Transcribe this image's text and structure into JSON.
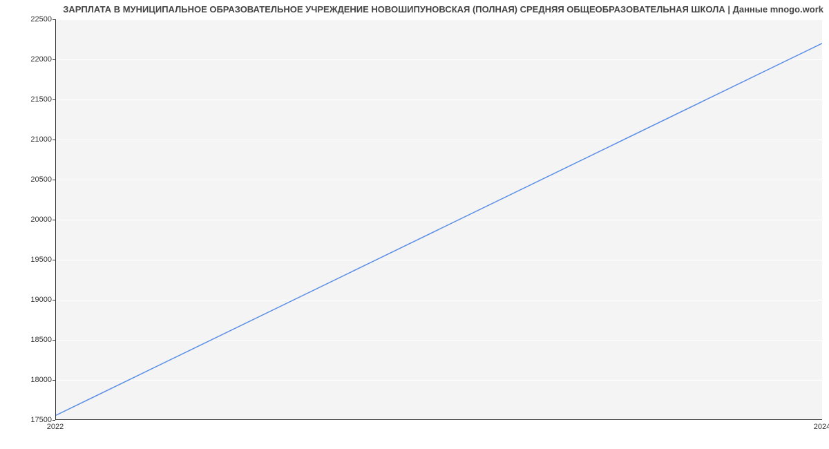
{
  "chart_data": {
    "type": "line",
    "title": "ЗАРПЛАТА В МУНИЦИПАЛЬНОЕ ОБРАЗОВАТЕЛЬНОЕ УЧРЕЖДЕНИЕ НОВОШИПУНОВСКАЯ (ПОЛНАЯ) СРЕДНЯЯ ОБЩЕОБРАЗОВАТЕЛЬНАЯ ШКОЛА | Данные mnogo.work",
    "xlabel": "",
    "ylabel": "",
    "x": [
      2022,
      2024
    ],
    "values": [
      17550,
      22200
    ],
    "xlim": [
      2022,
      2024
    ],
    "ylim": [
      17500,
      22500
    ],
    "x_ticks": [
      2022,
      2024
    ],
    "y_ticks": [
      17500,
      18000,
      18500,
      19000,
      19500,
      20000,
      20500,
      21000,
      21500,
      22000,
      22500
    ],
    "line_color": "#5b8ee6"
  }
}
